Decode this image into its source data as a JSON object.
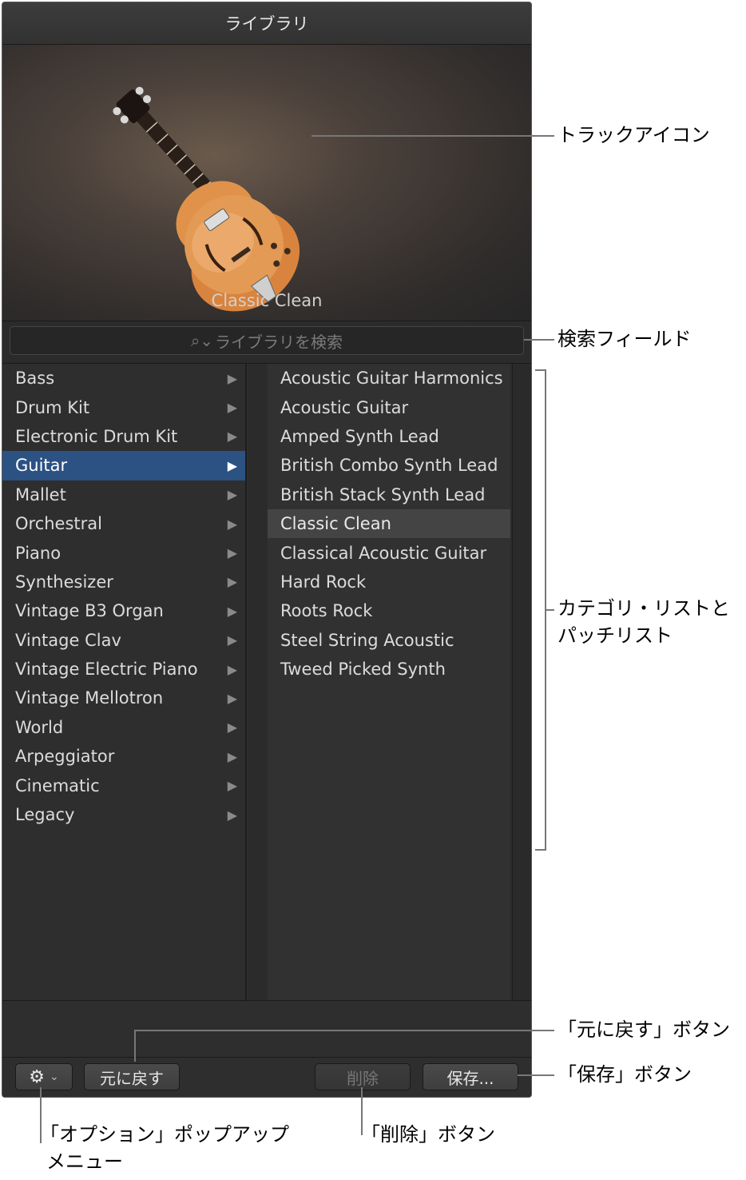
{
  "window": {
    "title": "ライブラリ"
  },
  "track": {
    "name": "Classic Clean"
  },
  "search": {
    "placeholder": "ライブラリを検索"
  },
  "categories": [
    {
      "label": "Bass"
    },
    {
      "label": "Drum Kit"
    },
    {
      "label": "Electronic Drum Kit"
    },
    {
      "label": "Guitar",
      "selected": true
    },
    {
      "label": "Mallet"
    },
    {
      "label": "Orchestral"
    },
    {
      "label": "Piano"
    },
    {
      "label": "Synthesizer"
    },
    {
      "label": "Vintage B3 Organ"
    },
    {
      "label": "Vintage Clav"
    },
    {
      "label": "Vintage Electric Piano"
    },
    {
      "label": "Vintage Mellotron"
    },
    {
      "label": "World"
    },
    {
      "label": "Arpeggiator"
    },
    {
      "label": "Cinematic"
    },
    {
      "label": "Legacy"
    }
  ],
  "patches": [
    {
      "label": "Acoustic Guitar Harmonics"
    },
    {
      "label": "Acoustic Guitar"
    },
    {
      "label": "Amped Synth Lead"
    },
    {
      "label": "British Combo Synth Lead"
    },
    {
      "label": "British Stack Synth Lead"
    },
    {
      "label": "Classic Clean",
      "selected": true
    },
    {
      "label": "Classical Acoustic Guitar"
    },
    {
      "label": "Hard Rock"
    },
    {
      "label": "Roots Rock"
    },
    {
      "label": "Steel String Acoustic"
    },
    {
      "label": "Tweed Picked Synth"
    }
  ],
  "toolbar": {
    "revert_label": "元に戻す",
    "delete_label": "削除",
    "save_label": "保存..."
  },
  "annotations": {
    "track_icon": "トラックアイコン",
    "search_field": "検索フィールド",
    "lists_line1": "カテゴリ・リストと",
    "lists_line2": "パッチリスト",
    "revert_button": "「元に戻す」ボタン",
    "save_button": "「保存」ボタン",
    "options_line1": "「オプション」ポップアップ",
    "options_line2": "メニュー",
    "delete_button": "「削除」ボタン"
  },
  "colors": {
    "selection": "#2c5183",
    "panel_bg": "#2e2e2e"
  }
}
